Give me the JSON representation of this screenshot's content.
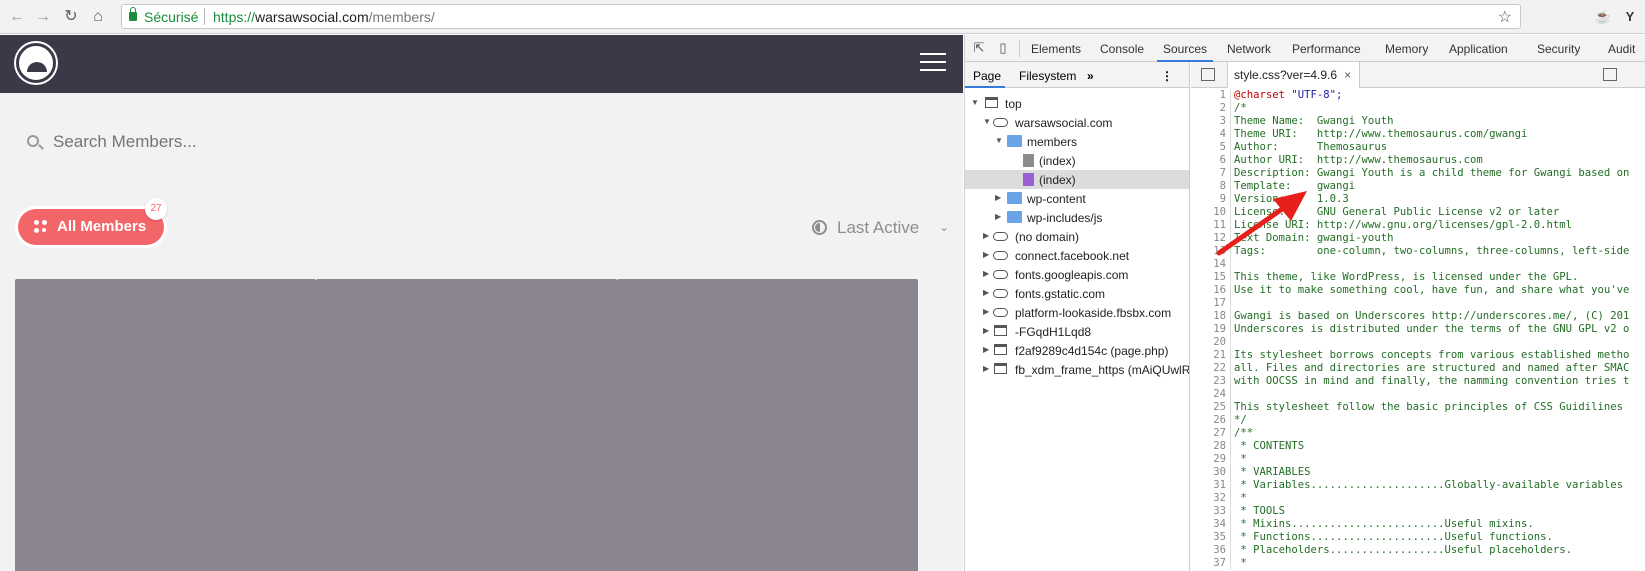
{
  "browser": {
    "back_icon": "arrow-left",
    "forward_icon": "arrow-right",
    "reload_icon": "reload",
    "home_icon": "home",
    "secure_label": "Sécurisé",
    "url_scheme": "https://",
    "url_host": "warsawsocial.com",
    "url_path": "/members/",
    "bookmark_icon": "star"
  },
  "site": {
    "search_placeholder": "Search Members...",
    "filter_label": "All Members",
    "member_count": "27",
    "sort_label": "Last Active",
    "accent_color": "#f2666a",
    "header_color": "#3b3847",
    "card_color": "#8a8590"
  },
  "devtools": {
    "tabs": [
      "Elements",
      "Console",
      "Sources",
      "Network",
      "Performance",
      "Memory",
      "Application",
      "Security",
      "Audit"
    ],
    "active_tab": "Sources",
    "nav_tabs": [
      "Page",
      "Filesystem"
    ],
    "tree": [
      {
        "label": "top"
      },
      {
        "label": "warsawsocial.com"
      },
      {
        "label": "members"
      },
      {
        "label": "(index)"
      },
      {
        "label": "(index)"
      },
      {
        "label": "wp-content"
      },
      {
        "label": "wp-includes/js"
      },
      {
        "label": "(no domain)"
      },
      {
        "label": "connect.facebook.net"
      },
      {
        "label": "fonts.googleapis.com"
      },
      {
        "label": "fonts.gstatic.com"
      },
      {
        "label": "platform-lookaside.fbsbx.com"
      },
      {
        "label": "-FGqdH1Lqd8"
      },
      {
        "label": "f2af9289c4d154c (page.php)"
      },
      {
        "label": "fb_xdm_frame_https (mAiQUwlRel"
      }
    ],
    "editor_tab": "style.css?ver=4.9.6",
    "code_lines": [
      "@charset \"UTF-8\";",
      "/*",
      "Theme Name:  Gwangi Youth",
      "Theme URI:   http://www.themosaurus.com/gwangi",
      "Author:      Themosaurus",
      "Author URI:  http://www.themosaurus.com",
      "Description: Gwangi Youth is a child theme for Gwangi based on",
      "Template:    gwangi",
      "Version:     1.0.3",
      "License:     GNU General Public License v2 or later",
      "License URI: http://www.gnu.org/licenses/gpl-2.0.html",
      "Text Domain: gwangi-youth",
      "Tags:        one-column, two-columns, three-columns, left-side",
      "",
      "This theme, like WordPress, is licensed under the GPL.",
      "Use it to make something cool, have fun, and share what you've",
      "",
      "Gwangi is based on Underscores http://underscores.me/, (C) 201",
      "Underscores is distributed under the terms of the GNU GPL v2 o",
      "",
      "Its stylesheet borrows concepts from various established metho",
      "all. Files and directories are structured and named after SMAC",
      "with OOCSS in mind and finally, the namming convention tries t",
      "",
      "This stylesheet follow the basic principles of CSS Guidilines",
      "*/",
      "/**",
      " * CONTENTS",
      " *",
      " * VARIABLES",
      " * Variables.....................Globally-available variables",
      " *",
      " * TOOLS",
      " * Mixins........................Useful mixins.",
      " * Functions.....................Useful functions.",
      " * Placeholders..................Useful placeholders.",
      " *"
    ]
  }
}
